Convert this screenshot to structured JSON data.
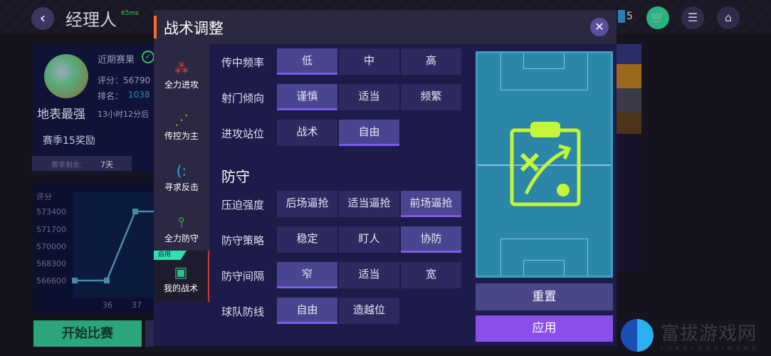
{
  "header": {
    "title": "经理人",
    "ping": "65ms",
    "ticket_count": "5"
  },
  "profile": {
    "name": "地表最强",
    "recent_label": "近期赛果",
    "score": "评分：56790",
    "rank_label": "排名：",
    "rank": "1038",
    "timer": "13小时12分后",
    "season_reward": "赛季15奖励",
    "season_left_label": "赛季剩余：",
    "season_left": "7天"
  },
  "chart_data": {
    "type": "line",
    "ylabel": "评分",
    "yticks": [
      "573400",
      "571700",
      "570000",
      "568300",
      "566600"
    ],
    "categories": [
      "",
      "36",
      "37"
    ],
    "values": [
      566600,
      566600,
      573400
    ],
    "ylim": [
      565000,
      575000
    ]
  },
  "start_button": "开始比赛",
  "modal": {
    "title": "战术调整",
    "sidebar": [
      {
        "label": "全力进攻",
        "icon": "attack-icon"
      },
      {
        "label": "传控为主",
        "icon": "possession-icon"
      },
      {
        "label": "寻求反击",
        "icon": "counter-icon"
      },
      {
        "label": "全力防守",
        "icon": "defend-icon"
      },
      {
        "label": "我的战术",
        "icon": "clipboard-icon",
        "badge": "启用",
        "active": true
      }
    ],
    "defense_heading": "防守",
    "rows": [
      {
        "label": "传中频率",
        "options": [
          "低",
          "中",
          "高"
        ],
        "selected": 0
      },
      {
        "label": "射门倾向",
        "options": [
          "谨慎",
          "适当",
          "频繁"
        ],
        "selected": 0
      },
      {
        "label": "进攻站位",
        "options": [
          "战术",
          "自由"
        ],
        "selected": 1
      },
      {
        "label": "压迫强度",
        "options": [
          "后场逼抢",
          "适当逼抢",
          "前场逼抢"
        ],
        "selected": 2
      },
      {
        "label": "防守策略",
        "options": [
          "稳定",
          "盯人",
          "协防"
        ],
        "selected": 2
      },
      {
        "label": "防守间隔",
        "options": [
          "窄",
          "适当",
          "宽"
        ],
        "selected": 0
      },
      {
        "label": "球队防线",
        "options": [
          "自由",
          "造越位"
        ],
        "selected": 0
      }
    ],
    "reset": "重置",
    "apply": "应用"
  },
  "watermark": {
    "text": "富拔游戏网",
    "sub": "FUBAYOUXIWANG"
  },
  "colors": {
    "accent": "#ff6a2a",
    "selected": "#4a4590",
    "apply": "#8a4fe8",
    "pitch": "#2c86a8",
    "start": "#2aa57c"
  }
}
